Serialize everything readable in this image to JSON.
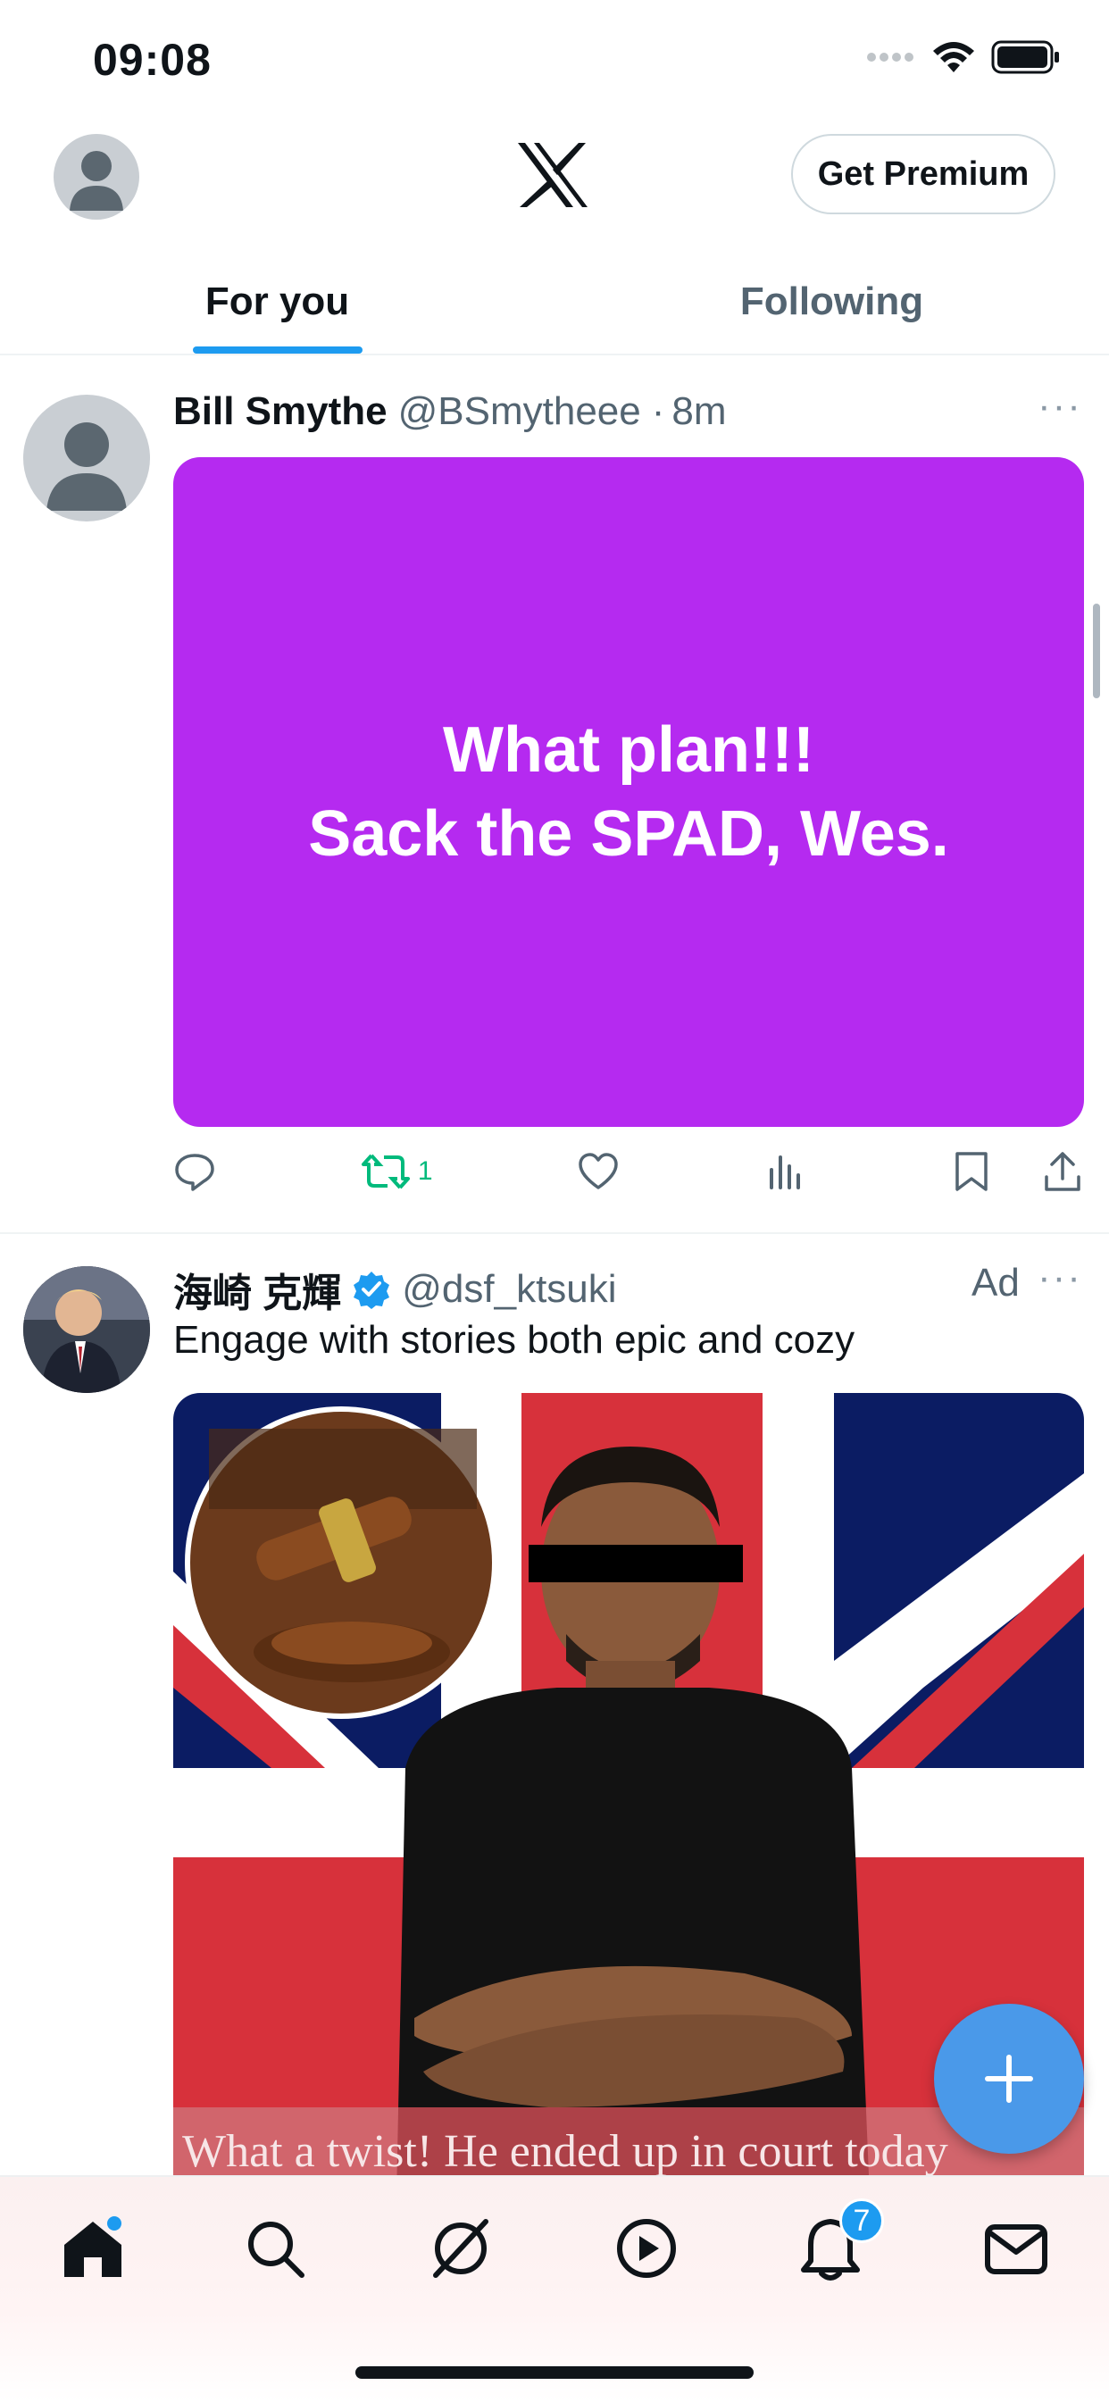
{
  "status_bar": {
    "time": "09:08"
  },
  "header": {
    "premium_label": "Get Premium",
    "logo_icon": "x-logo-icon"
  },
  "tabs": [
    {
      "label": "For you",
      "active": true
    },
    {
      "label": "Following",
      "active": false
    }
  ],
  "tweets": [
    {
      "name": "Bill Smythe",
      "handle": "@BSmytheee",
      "separator": "·",
      "time": "8m",
      "media_text_line1": "What plan!!!",
      "media_text_line2": "Sack the SPAD, Wes.",
      "media_color": "#b52af0",
      "retweet_count": "1"
    },
    {
      "name": "海崎 克輝",
      "verified": true,
      "handle": "@dsf_ktsuki",
      "ad_label": "Ad",
      "text": "Engage with stories both epic and cozy",
      "media_caption": "What a twist! He ended up in court today"
    }
  ],
  "bottom_nav": {
    "items": [
      "home-icon",
      "search-icon",
      "grok-icon",
      "video-icon",
      "notifications-icon",
      "messages-icon"
    ],
    "notification_badge": "7"
  },
  "colors": {
    "accent": "#1d9bf0",
    "retweet": "#00ba7c",
    "fab": "#4a99e9"
  }
}
